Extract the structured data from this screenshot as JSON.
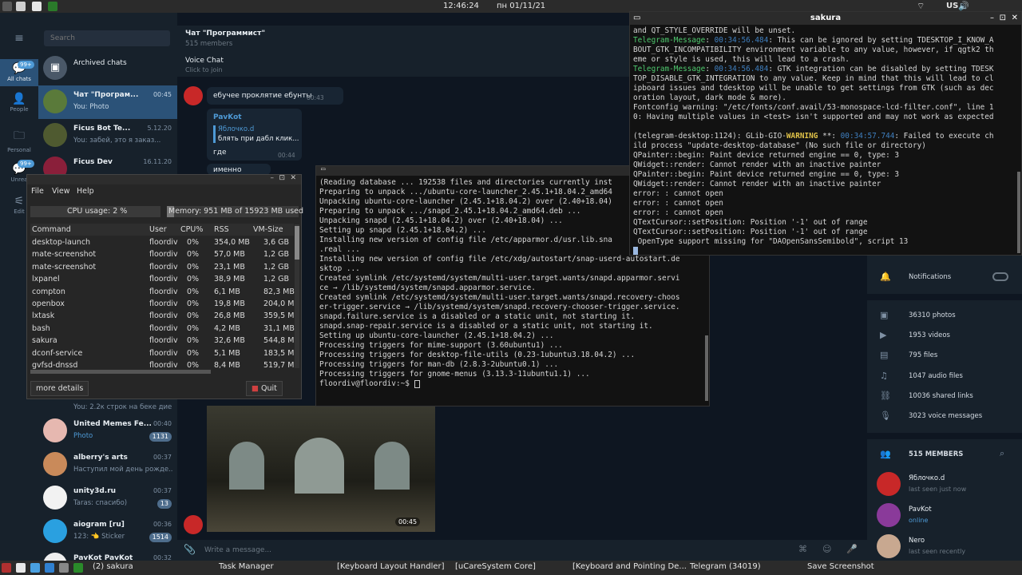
{
  "topbar": {
    "time": "12:46:24",
    "date": "пн 01/11/21",
    "kbd": "US"
  },
  "rail": {
    "all_chats": "All chats",
    "all_badge": "99+",
    "people": "People",
    "personal": "Personal",
    "unread": "Unrea",
    "unread_badge": "99+",
    "edit": "Edit"
  },
  "search": {
    "placeholder": "Search"
  },
  "chats": [
    {
      "title": "Archived chats",
      "snippet": "",
      "time": "",
      "count": ""
    },
    {
      "title": "Чат \"Програм...",
      "snippet": "You: Photo",
      "time": "00:45",
      "count": ""
    },
    {
      "title": "Ficus Bot Te...",
      "snippet": "You: забей, это я заказ...",
      "time": "5.12.20",
      "count": ""
    },
    {
      "title": "Ficus Dev",
      "snippet": "",
      "time": "16.11.20",
      "count": ""
    },
    {
      "title": "",
      "snippet": "You: 2.2к строк на беке дие",
      "time": "",
      "count": ""
    },
    {
      "title": "United Memes Fe...",
      "snippet": "Photo",
      "time": "00:40",
      "count": "1131"
    },
    {
      "title": "alberry's arts",
      "snippet": "Наступил мой день рожде...",
      "time": "00:37",
      "count": ""
    },
    {
      "title": "unity3d.ru",
      "snippet": "Taras: спасибо)",
      "time": "00:37",
      "count": "13"
    },
    {
      "title": "aiogram [ru]",
      "snippet": "123: 👈 Sticker",
      "time": "00:36",
      "count": "1514"
    },
    {
      "title": "PavKot PavKot",
      "snippet": "",
      "time": "00:32",
      "count": ""
    }
  ],
  "chat": {
    "title": "Чат \"Программист\"",
    "members": "515 members",
    "voice": "Voice Chat",
    "voice_sub": "Click to join",
    "msg1": "ебучее проклятие ебунты",
    "msg1_time": "00:43",
    "reply_author": "PavKot",
    "reply_name": "Яблочко.d",
    "reply_text": "блять при дабл клик...",
    "reply_msg": "где",
    "reply_time": "00:44",
    "msg3": "именно",
    "photo_time": "00:45",
    "composer": "Write a message..."
  },
  "right": {
    "notifications": "Notifications",
    "photos": "36310 photos",
    "videos": "1953 videos",
    "files": "795 files",
    "audio": "1047 audio files",
    "links": "10036 shared links",
    "voice": "3023 voice messages",
    "members": "515 MEMBERS",
    "m1": "Яблочко.d",
    "m1s": "last seen just now",
    "m2": "PavKot",
    "m2s": "online",
    "m3": "Nero",
    "m3s": "last seen recently"
  },
  "taskman": {
    "menu": [
      "File",
      "View",
      "Help"
    ],
    "cpu": "CPU usage: 2 %",
    "memory": "Memory: 951 MB of 15923 MB used",
    "cols": [
      "Command",
      "User",
      "CPU%",
      "RSS",
      "VM-Size"
    ],
    "rows": [
      [
        "desktop-launch",
        "floordiv",
        "0%",
        "354,0 MB",
        "3,6 GB"
      ],
      [
        "mate-screenshot",
        "floordiv",
        "0%",
        "57,0 MB",
        "1,2 GB"
      ],
      [
        "mate-screenshot",
        "floordiv",
        "0%",
        "23,1 MB",
        "1,2 GB"
      ],
      [
        "lxpanel",
        "floordiv",
        "0%",
        "38,9 MB",
        "1,2 GB"
      ],
      [
        "compton",
        "floordiv",
        "0%",
        "6,1 MB",
        "82,3 MB"
      ],
      [
        "openbox",
        "floordiv",
        "0%",
        "19,8 MB",
        "204,0 MB"
      ],
      [
        "lxtask",
        "floordiv",
        "0%",
        "26,8 MB",
        "359,5 MB"
      ],
      [
        "bash",
        "floordiv",
        "0%",
        "4,2 MB",
        "31,1 MB"
      ],
      [
        "sakura",
        "floordiv",
        "0%",
        "32,6 MB",
        "544,8 MB"
      ],
      [
        "dconf-service",
        "floordiv",
        "0%",
        "5,1 MB",
        "183,5 MB"
      ],
      [
        "gvfsd-dnssd",
        "floordiv",
        "0%",
        "8,4 MB",
        "519,7 MB"
      ]
    ],
    "more": "more details",
    "quit": "Quit"
  },
  "term": {
    "text": "(Reading database ... 192538 files and directories currently inst\nPreparing to unpack .../ubuntu-core-launcher_2.45.1+18.04.2_amd64\nUnpacking ubuntu-core-launcher (2.45.1+18.04.2) over (2.40+18.04)\nPreparing to unpack .../snapd_2.45.1+18.04.2_amd64.deb ...\nUnpacking snapd (2.45.1+18.04.2) over (2.40+18.04) ...\nSetting up snapd (2.45.1+18.04.2) ...\nInstalling new version of config file /etc/apparmor.d/usr.lib.sna\n.real ...\nInstalling new version of config file /etc/xdg/autostart/snap-userd-autostart.de\nsktop ...\nCreated symlink /etc/systemd/system/multi-user.target.wants/snapd.apparmor.servi\nce → /lib/systemd/system/snapd.apparmor.service.\nCreated symlink /etc/systemd/system/multi-user.target.wants/snapd.recovery-choos\ner-trigger.service → /lib/systemd/system/snapd.recovery-chooser-trigger.service.\nsnapd.failure.service is a disabled or a static unit, not starting it.\nsnapd.snap-repair.service is a disabled or a static unit, not starting it.\nSetting up ubuntu-core-launcher (2.45.1+18.04.2) ...\nProcessing triggers for mime-support (3.60ubuntu1) ...\nProcessing triggers for desktop-file-utils (0.23-1ubuntu3.18.04.2) ...\nProcessing triggers for man-db (2.8.3-2ubuntu0.1) ...\nProcessing triggers for gnome-menus (3.13.3-11ubuntu1.1) ...",
    "prompt": "floordiv@floordiv:~$ "
  },
  "sakura": {
    "title": "sakura",
    "l1": "and QT_STYLE_OVERRIDE will be unset.",
    "tm1": "Telegram-Message",
    "t1": "00:34:56.484",
    "l2": ": This can be ignored by setting TDESKTOP_I_KNOW_A\nBOUT_GTK_INCOMPATIBILITY environment variable to any value, however, if qgtk2 th\neme or style is used, this will lead to a crash.",
    "tm2": "Telegram-Message",
    "t2": "00:34:56.484",
    "l3": ": GTK integration can be disabled by setting TDESK\nTOP_DISABLE_GTK_INTEGRATION to any value. Keep in mind that this will lead to cl\nipboard issues and tdesktop will be unable to get settings from GTK (such as dec\noration layout, dark mode & more).\nFontconfig warning: \"/etc/fonts/conf.avail/53-monospace-lcd-filter.conf\", line 1\n0: Having multiple values in <test> isn't supported and may not work as expected",
    "l4a": "(telegram-desktop:1124): GLib-GIO-",
    "warn": "WARNING",
    "l4b": " **: ",
    "t3": "00:34:57.744",
    "l4c": ": Failed to execute ch\nild process \"update-desktop-database\" (No such file or directory)\nQPainter::begin: Paint device returned engine == 0, type: 3\nQWidget::render: Cannot render with an inactive painter\nQPainter::begin: Paint device returned engine == 0, type: 3\nQWidget::render: Cannot render with an inactive painter\nerror: : cannot open\nerror: : cannot open\nerror: : cannot open\nQTextCursor::setPosition: Position '-1' out of range\nQTextCursor::setPosition: Position '-1' out of range\n OpenType support missing for \"DAOpenSansSemibold\", script 13"
  },
  "taskbar": {
    "sakura": "(2) sakura",
    "taskman": "Task Manager",
    "kbd": "[Keyboard Layout Handler]",
    "ucare": "[uCareSystem Core]",
    "kbdp": "[Keyboard and Pointing De...",
    "telegram": "Telegram (34019)",
    "shot": "Save Screenshot"
  }
}
